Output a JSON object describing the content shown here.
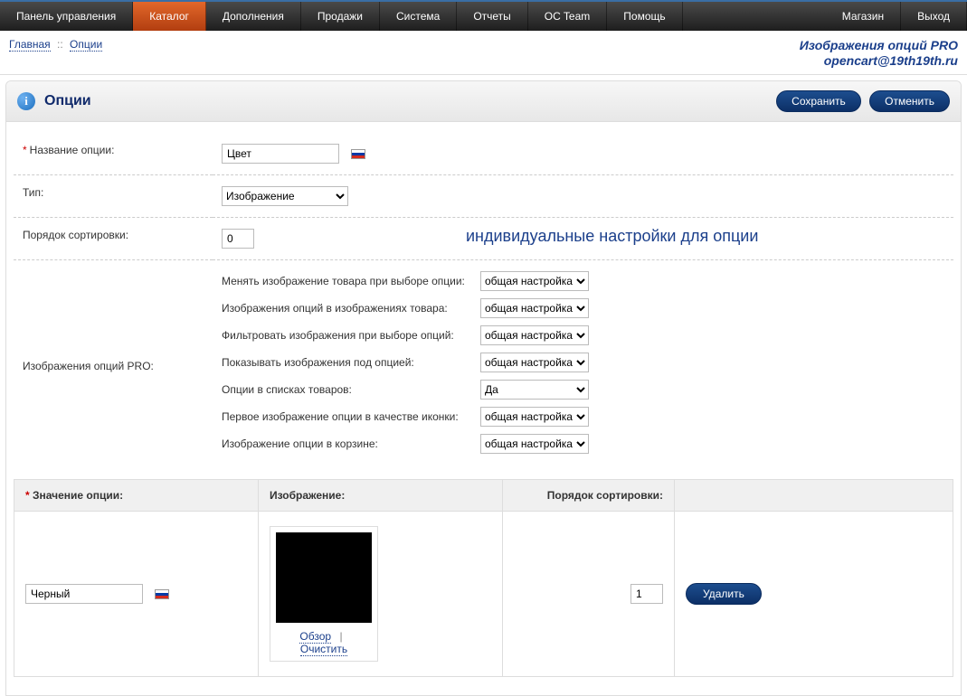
{
  "menu": {
    "left": [
      "Панель управления",
      "Каталог",
      "Дополнения",
      "Продажи",
      "Система",
      "Отчеты",
      "OC Team",
      "Помощь"
    ],
    "right": [
      "Магазин",
      "Выход"
    ],
    "active_index": 1
  },
  "breadcrumb": {
    "home": "Главная",
    "current": "Опции"
  },
  "promo": {
    "line1": "Изображения опций PRO",
    "line2": "opencart@19th19th.ru"
  },
  "header": {
    "title": "Опции",
    "save": "Сохранить",
    "cancel": "Отменить"
  },
  "form": {
    "name_label": "Название опции:",
    "name_value": "Цвет",
    "type_label": "Тип:",
    "type_value": "Изображение",
    "sort_label": "Порядок сортировки:",
    "sort_value": "0",
    "banner": "индивидуальные настройки для опции",
    "pro_label": "Изображения опций PRO:",
    "pro_settings": [
      {
        "label": "Менять изображение товара при выборе опции:",
        "value": "общая настройка"
      },
      {
        "label": "Изображения опций в изображениях товара:",
        "value": "общая настройка"
      },
      {
        "label": "Фильтровать изображения при выборе опций:",
        "value": "общая настройка"
      },
      {
        "label": "Показывать изображения под опцией:",
        "value": "общая настройка"
      },
      {
        "label": "Опции в списках товаров:",
        "value": "Да"
      },
      {
        "label": "Первое изображение опции в качестве иконки:",
        "value": "общая настройка"
      },
      {
        "label": "Изображение опции в корзине:",
        "value": "общая настройка"
      }
    ]
  },
  "values_table": {
    "headers": {
      "name": "Значение опции:",
      "image": "Изображение:",
      "sort": "Порядок сортировки:"
    },
    "row": {
      "name": "Черный",
      "sort": "1",
      "browse": "Обзор",
      "clear": "Очистить",
      "delete": "Удалить"
    }
  }
}
